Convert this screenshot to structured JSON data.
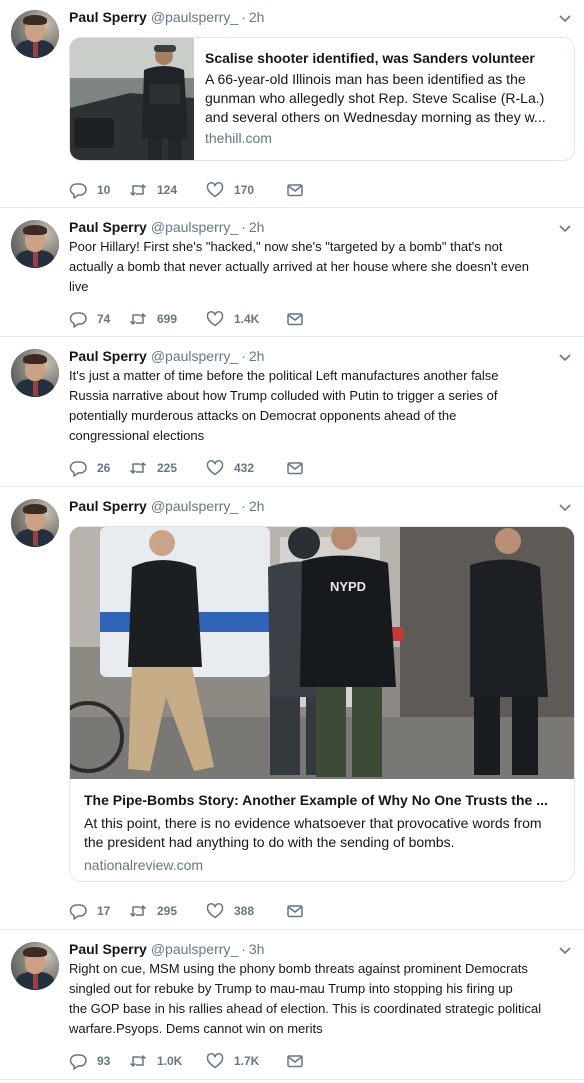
{
  "colors": {
    "text_primary": "#14171a",
    "text_secondary": "#657786",
    "border": "#e6ecf0",
    "card_border": "#e1e8ed"
  },
  "tweets": [
    {
      "author_name": "Paul Sperry",
      "handle": "@paulsperry_",
      "separator": "·",
      "time": "2h",
      "text_lines": [],
      "card": {
        "title": "Scalise shooter identified, was Sanders volunteer",
        "description_lines": [
          "A 66-year-old Illinois man has been identified as the",
          "gunman who allegedly shot Rep. Steve Scalise (R-La.)",
          "and several others on Wednesday morning as they w..."
        ],
        "domain": "thehill.com"
      },
      "replies": "10",
      "retweets": "124",
      "likes": "170"
    },
    {
      "author_name": "Paul Sperry",
      "handle": "@paulsperry_",
      "separator": "·",
      "time": "2h",
      "text_lines": [
        "Poor Hillary! First she's \"hacked,\" now she's \"targeted by a bomb\" that's not",
        "actually a bomb that never actually arrived at her house where she doesn't even",
        "live"
      ],
      "replies": "74",
      "retweets": "699",
      "likes": "1.4K"
    },
    {
      "author_name": "Paul Sperry",
      "handle": "@paulsperry_",
      "separator": "·",
      "time": "2h",
      "text_lines": [
        "It's just a matter of time before the political Left manufactures another false",
        "Russia narrative about how Trump colluded with Putin to trigger a series of",
        "potentially murderous attacks on Democrat opponents ahead of the",
        "congressional elections"
      ],
      "replies": "26",
      "retweets": "225",
      "likes": "432"
    },
    {
      "author_name": "Paul Sperry",
      "handle": "@paulsperry_",
      "separator": "·",
      "time": "2h",
      "text_lines": [],
      "card": {
        "image_text": "NYPD",
        "title": "The Pipe-Bombs Story: Another Example of Why No One Trusts the ...",
        "description_lines": [
          "At this point, there is no evidence whatsoever that provocative words from",
          "the president had anything to do with the sending of bombs."
        ],
        "domain": "nationalreview.com"
      },
      "replies": "17",
      "retweets": "295",
      "likes": "388"
    },
    {
      "author_name": "Paul Sperry",
      "handle": "@paulsperry_",
      "separator": "·",
      "time": "3h",
      "text_lines": [
        "Right on cue, MSM using the phony bomb threats against prominent Democrats",
        "singled out for rebuke by Trump to mau-mau Trump into stopping his firing up",
        "the GOP base in his rallies ahead of election. This is coordinated strategic political",
        "warfare.Psyops. Dems cannot win on merits"
      ],
      "replies": "93",
      "retweets": "1.0K",
      "likes": "1.7K"
    }
  ],
  "icons": {
    "reply": "reply-icon",
    "retweet": "retweet-icon",
    "like": "heart-icon",
    "dm": "envelope-icon",
    "caret": "chevron-down-icon"
  }
}
